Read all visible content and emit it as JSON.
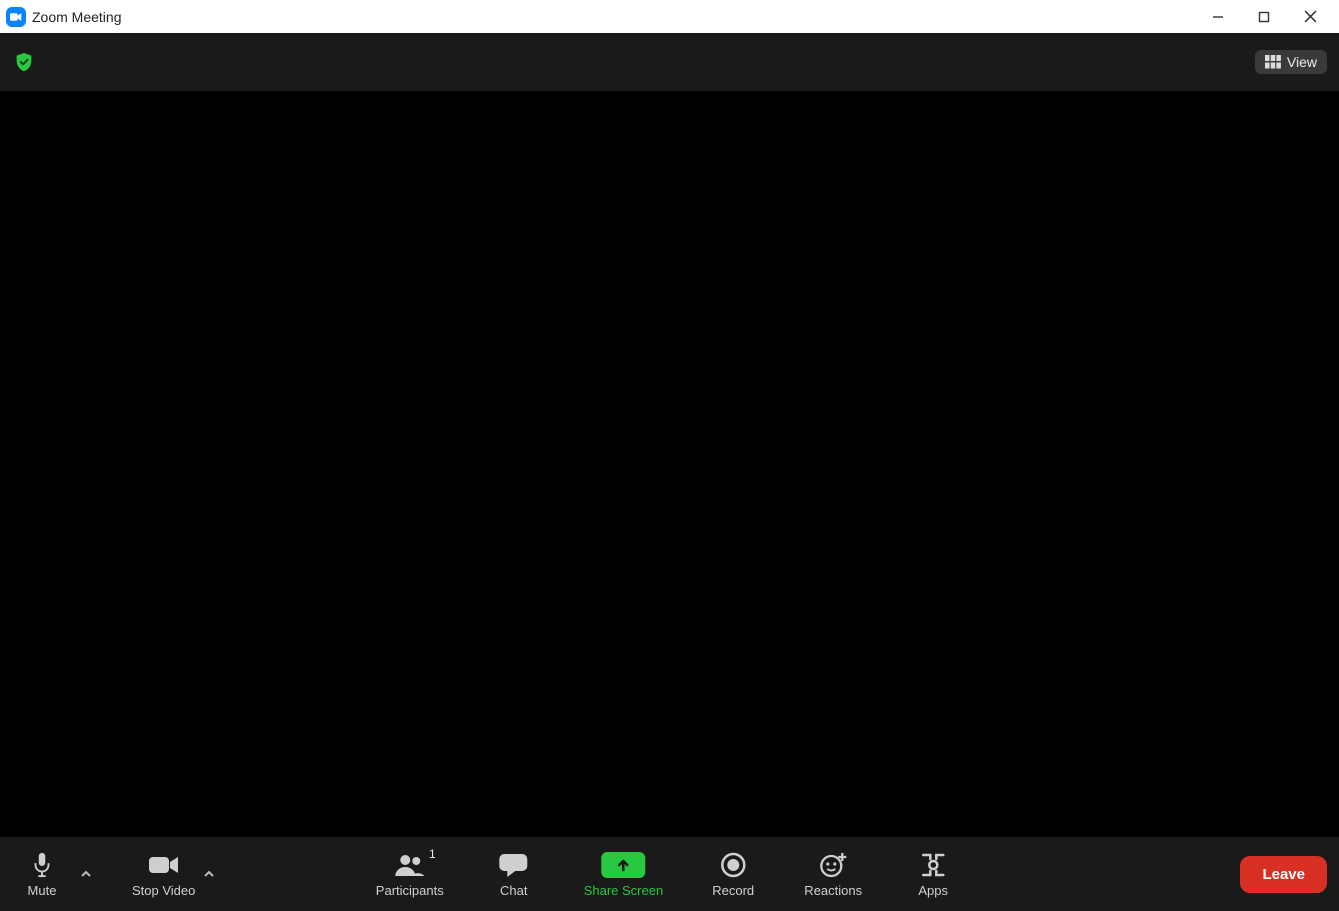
{
  "window": {
    "title": "Zoom Meeting"
  },
  "topbar": {
    "view_label": "View"
  },
  "toolbar": {
    "mute_label": "Mute",
    "stop_video_label": "Stop Video",
    "participants_label": "Participants",
    "participants_count": "1",
    "chat_label": "Chat",
    "share_label": "Share Screen",
    "record_label": "Record",
    "reactions_label": "Reactions",
    "apps_label": "Apps",
    "leave_label": "Leave"
  }
}
